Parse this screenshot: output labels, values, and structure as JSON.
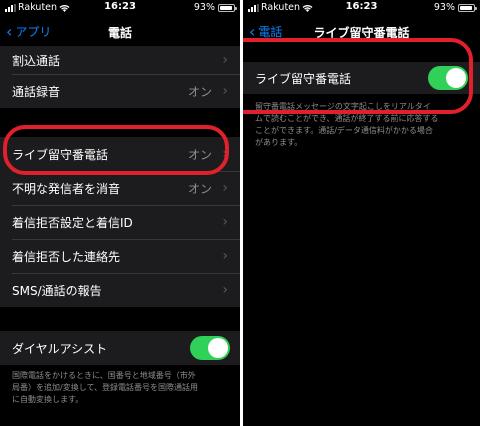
{
  "left": {
    "status": {
      "carrier": "Rakuten",
      "time": "16:23",
      "battery": "93%"
    },
    "nav": {
      "back": "アプリ",
      "title": "電話"
    },
    "rows_top": [
      {
        "label": "割込通話"
      },
      {
        "label": "通話録音",
        "value": "オン"
      }
    ],
    "rows_mid": [
      {
        "label": "ライブ留守番電話",
        "value": "オン"
      },
      {
        "label": "不明な発信者を消音",
        "value": "オン"
      },
      {
        "label": "着信拒否設定と着信ID"
      },
      {
        "label": "着信拒否した連絡先"
      },
      {
        "label": "SMS/通話の報告"
      }
    ],
    "dial_assist": {
      "label": "ダイヤルアシスト",
      "on": true
    },
    "footer": [
      "国際電話をかけるときに、国番号と地域番号（市外",
      "局番）を追加/変換して、登録電話番号を国際通話用",
      "に自動変換します。"
    ]
  },
  "right": {
    "status": {
      "carrier": "Rakuten",
      "time": "16:23",
      "battery": "93%"
    },
    "nav": {
      "back": "電話",
      "title": "ライブ留守番電話"
    },
    "toggle": {
      "label": "ライブ留守番電話",
      "on": true
    },
    "footer": [
      "留守番電話メッセージの文字起こしをリアルタイ",
      "ムで読むことができ、通話が終了する前に応答する",
      "ことができます。通話/データ通信料がかかる場合",
      "があります。"
    ]
  },
  "colors": {
    "accent": "#0a84ff",
    "toggle_on": "#30d158",
    "highlight_ring": "#e0202a",
    "background": "#000000",
    "cell": "#1c1c1e"
  },
  "icons": [
    "wifi-icon",
    "signal-icon",
    "battery-icon",
    "chevron-left-icon",
    "chevron-right-icon"
  ]
}
